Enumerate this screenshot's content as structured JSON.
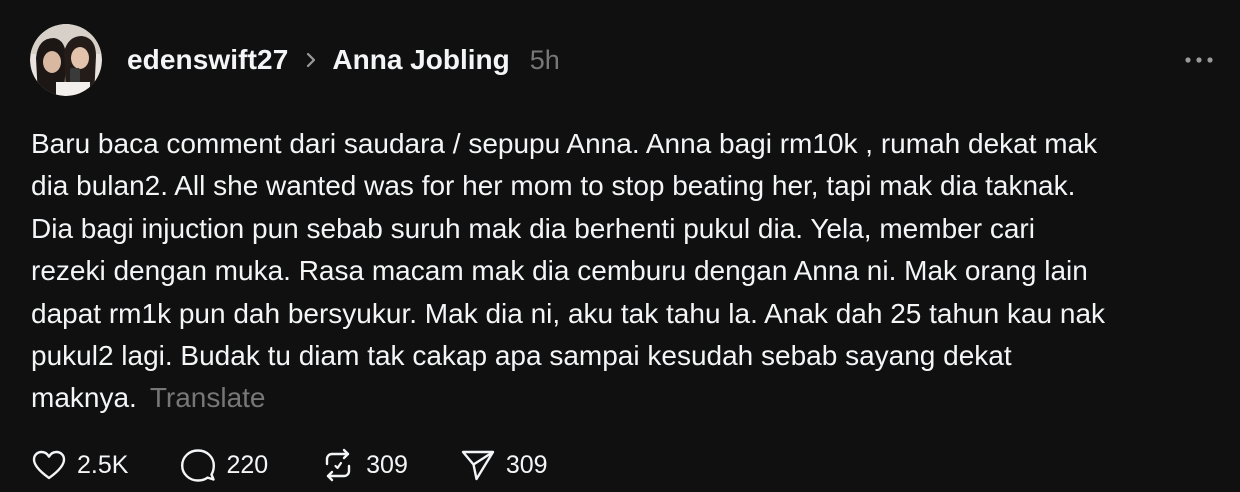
{
  "post": {
    "author": "edenswift27",
    "recipient": "Anna Jobling",
    "timestamp": "5h",
    "lines": [
      "Baru baca comment dari saudara / sepupu Anna. Anna bagi rm10k , rumah dekat mak",
      "dia bulan2. All she wanted was for her mom to stop beating her, tapi mak dia taknak.",
      "Dia bagi injuction pun sebab suruh mak dia berhenti pukul dia. Yela, member cari",
      "rezeki dengan muka. Rasa macam mak dia cemburu dengan Anna ni. Mak orang lain",
      "dapat rm1k pun dah bersyukur. Mak dia ni, aku tak tahu la. Anak dah 25 tahun kau nak",
      "pukul2 lagi. Budak tu diam tak cakap apa sampai kesudah sebab sayang dekat",
      "maknya."
    ],
    "translate_label": "Translate",
    "actions": {
      "likes": "2.5K",
      "replies": "220",
      "reposts": "309",
      "shares": "309"
    }
  },
  "icons": {
    "avatar": "avatar-photo",
    "chevron": "chevron-right-icon",
    "more": "more-horizontal-icon",
    "like": "heart-icon",
    "reply": "comment-bubble-icon",
    "repost": "repost-icon",
    "share": "send-icon"
  },
  "colors": {
    "background": "#101010",
    "text": "#f3f5f7",
    "secondary": "#777777"
  }
}
